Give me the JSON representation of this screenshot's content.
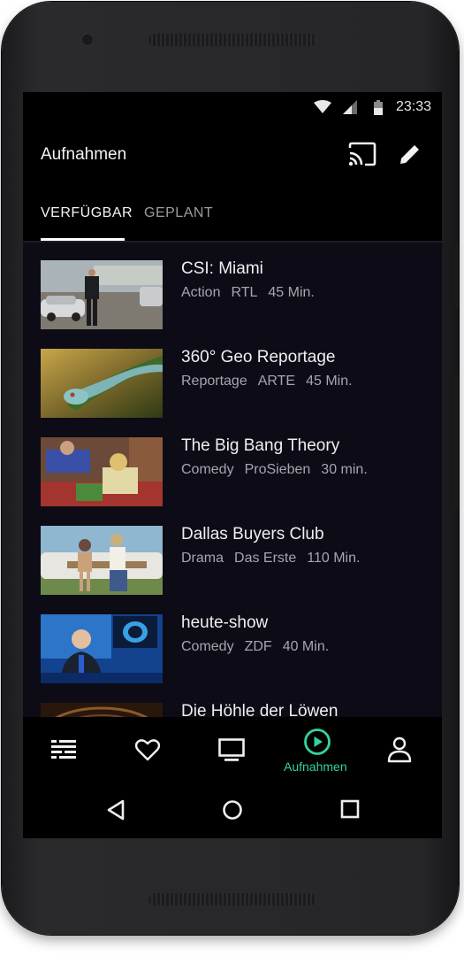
{
  "status_bar": {
    "time": "23:33"
  },
  "app_bar": {
    "title": "Aufnahmen",
    "cast_icon": "cast-icon",
    "edit_icon": "pencil-icon"
  },
  "tabs": [
    {
      "label": "VERFÜGBAR",
      "active": true
    },
    {
      "label": "GEPLANT",
      "active": false
    }
  ],
  "recordings": [
    {
      "title": "CSI: Miami",
      "genre": "Action",
      "channel": "RTL",
      "duration": "45 Min."
    },
    {
      "title": "360° Geo Reportage",
      "genre": "Reportage",
      "channel": "ARTE",
      "duration": "45 Min."
    },
    {
      "title": "The Big Bang Theory",
      "genre": "Comedy",
      "channel": "ProSieben",
      "duration": "30 min."
    },
    {
      "title": "Dallas Buyers Club",
      "genre": "Drama",
      "channel": "Das Erste",
      "duration": "110 Min."
    },
    {
      "title": "heute-show",
      "genre": "Comedy",
      "channel": "ZDF",
      "duration": "40 Min."
    },
    {
      "title": "Die Höhle der Löwen",
      "genre": "",
      "channel": "",
      "duration": ""
    }
  ],
  "bottom_nav": {
    "items": [
      {
        "icon": "guide-list-icon"
      },
      {
        "icon": "heart-icon"
      },
      {
        "icon": "tv-icon"
      },
      {
        "icon": "play-circle-icon",
        "label": "Aufnahmen",
        "active": true
      },
      {
        "icon": "profile-icon"
      }
    ]
  },
  "colors": {
    "accent": "#35d29c",
    "list_background": "#0c0b16",
    "background": "#000000"
  }
}
